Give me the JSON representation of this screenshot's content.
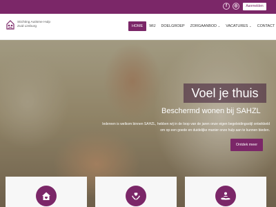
{
  "topbar": {
    "facebook_glyph": "f",
    "instagram_glyph": "◎",
    "login_label": "Aanmelden",
    "background": "#7b2768"
  },
  "logo": {
    "line1": "Stichting Autisme Hulp",
    "line2": "Zuid Limburg"
  },
  "nav": {
    "items": [
      {
        "label": "HOME",
        "active": true
      },
      {
        "label": "WIJ"
      },
      {
        "label": "DOELGROEP"
      },
      {
        "label": "ZORGAANBOD",
        "has_submenu": true
      },
      {
        "label": "VACATURES",
        "has_submenu": true
      },
      {
        "label": "CONTACT"
      }
    ]
  },
  "hero": {
    "title": "Voel je thuis",
    "subtitle": "Beschermd wonen bij SAHZL",
    "text": "Iedereen is welkom binnen SAHZL, hebben wij in de loop van de jaren onze eigen begeleidingsstijl ontwikkeld om op een goede en duidelijke manier onze hulp aan te kunnen bieden.",
    "button_label": "Ontdek meer"
  },
  "cards": [
    {
      "icon": "home-icon"
    },
    {
      "icon": "heart-hands-icon"
    },
    {
      "icon": "helping-hand-icon"
    }
  ],
  "colors": {
    "accent": "#7b2768",
    "card_bg": "#f7f7f7"
  }
}
